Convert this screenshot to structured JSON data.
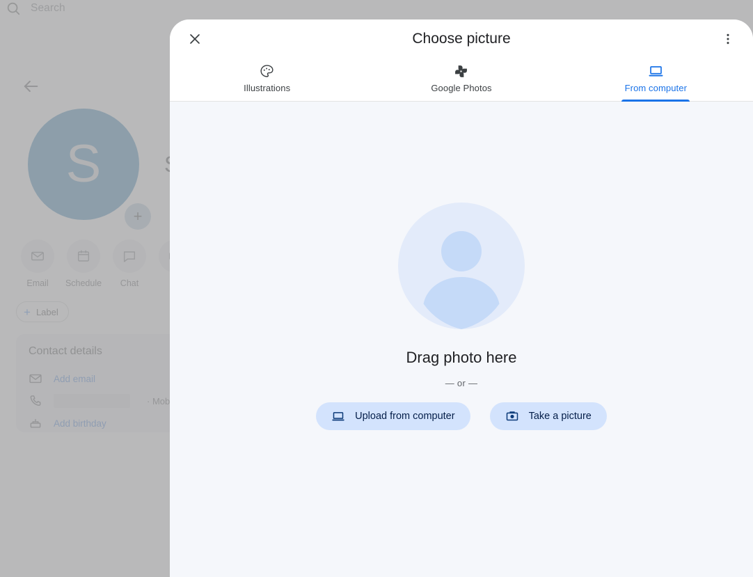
{
  "background": {
    "search": {
      "placeholder": "Search",
      "icon": "search-icon"
    },
    "back_icon": "back-arrow-icon",
    "contact": {
      "initial": "S",
      "name": "S",
      "add_photo_icon": "plus-icon",
      "avatar_color": "#0b6ba8"
    },
    "actions": [
      {
        "label": "Email",
        "icon": "email-icon"
      },
      {
        "label": "Schedule",
        "icon": "calendar-icon"
      },
      {
        "label": "Chat",
        "icon": "chat-icon"
      },
      {
        "label": "V",
        "icon": "video-icon"
      }
    ],
    "label_chip": {
      "label": "Label",
      "icon": "plus-icon"
    },
    "details": {
      "title": "Contact details",
      "rows": [
        {
          "icon": "email-icon",
          "link": "Add email",
          "redacted": false,
          "sub": ""
        },
        {
          "icon": "phone-icon",
          "link": "",
          "redacted": true,
          "sub": "· Mobile"
        },
        {
          "icon": "cake-icon",
          "link": "Add birthday",
          "redacted": false,
          "sub": ""
        }
      ]
    }
  },
  "dialog": {
    "title": "Choose picture",
    "close_icon": "close-icon",
    "more_icon": "more-vert-icon",
    "tabs": [
      {
        "label": "Illustrations",
        "icon": "palette-icon",
        "active": false
      },
      {
        "label": "Google Photos",
        "icon": "pinwheel-icon",
        "active": false
      },
      {
        "label": "From computer",
        "icon": "laptop-icon",
        "active": true
      }
    ],
    "body": {
      "placeholder_icon": "person-avatar-placeholder-icon",
      "drag_text": "Drag photo here",
      "or_text": "— or —",
      "buttons": [
        {
          "label": "Upload from computer",
          "icon": "laptop-icon"
        },
        {
          "label": "Take a picture",
          "icon": "camera-icon"
        }
      ]
    }
  },
  "colors": {
    "accent": "#1a73e8",
    "pill_bg": "#d3e3fd",
    "pill_text": "#041e49",
    "body_bg": "#f5f7fb"
  }
}
